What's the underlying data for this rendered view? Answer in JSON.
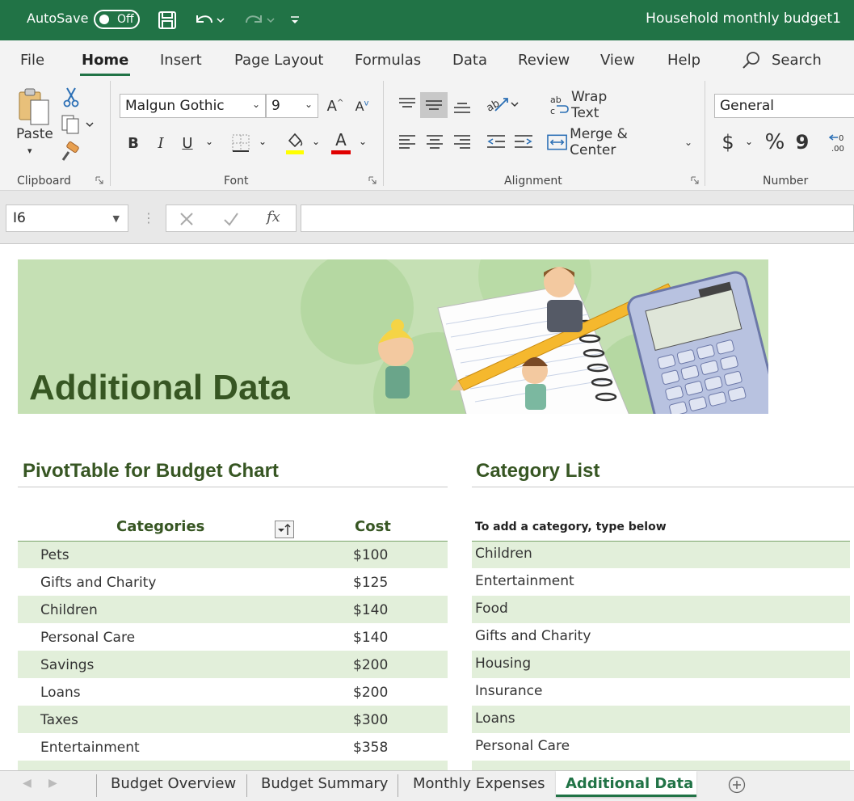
{
  "titlebar": {
    "autosave_label": "AutoSave",
    "autosave_state": "Off",
    "document_title": "Household monthly budget1"
  },
  "ribbon_tabs": [
    "File",
    "Home",
    "Insert",
    "Page Layout",
    "Formulas",
    "Data",
    "Review",
    "View",
    "Help"
  ],
  "search_label": "Search",
  "clipboard": {
    "paste_label": "Paste",
    "group_label": "Clipboard"
  },
  "font": {
    "family": "Malgun Gothic",
    "size": "9",
    "group_label": "Font",
    "bold": "B",
    "italic": "I",
    "underline": "U",
    "font_color_glyph": "A"
  },
  "alignment": {
    "wrap_text": "Wrap Text",
    "merge_center": "Merge & Center",
    "group_label": "Alignment"
  },
  "number": {
    "format": "General",
    "group_label": "Number",
    "currency": "$",
    "percent": "%",
    "comma": "9"
  },
  "formula_bar": {
    "cell_ref": "I6",
    "fx": "fx",
    "value": ""
  },
  "banner": {
    "title": "Additional Data"
  },
  "pivot": {
    "title": "PivotTable for Budget Chart",
    "headers": {
      "category": "Categories",
      "cost": "Cost"
    },
    "rows": [
      {
        "category": "Pets",
        "cost": "$100"
      },
      {
        "category": "Gifts and Charity",
        "cost": "$125"
      },
      {
        "category": "Children",
        "cost": "$140"
      },
      {
        "category": "Personal Care",
        "cost": "$140"
      },
      {
        "category": "Savings",
        "cost": "$200"
      },
      {
        "category": "Loans",
        "cost": "$200"
      },
      {
        "category": "Taxes",
        "cost": "$300"
      },
      {
        "category": "Entertainment",
        "cost": "$358"
      }
    ]
  },
  "category_list": {
    "title": "Category List",
    "hint": "To add a category, type below",
    "items": [
      "Children",
      "Entertainment",
      "Food",
      "Gifts and Charity",
      "Housing",
      "Insurance",
      "Loans",
      "Personal Care"
    ]
  },
  "sheet_tabs": [
    "Budget Overview",
    "Budget Summary",
    "Monthly Expenses",
    "Additional Data"
  ],
  "colors": {
    "excel_green": "#217346",
    "banner_green": "#c5e0b4",
    "title_green": "#375623",
    "row_shade": "#e2efda"
  }
}
